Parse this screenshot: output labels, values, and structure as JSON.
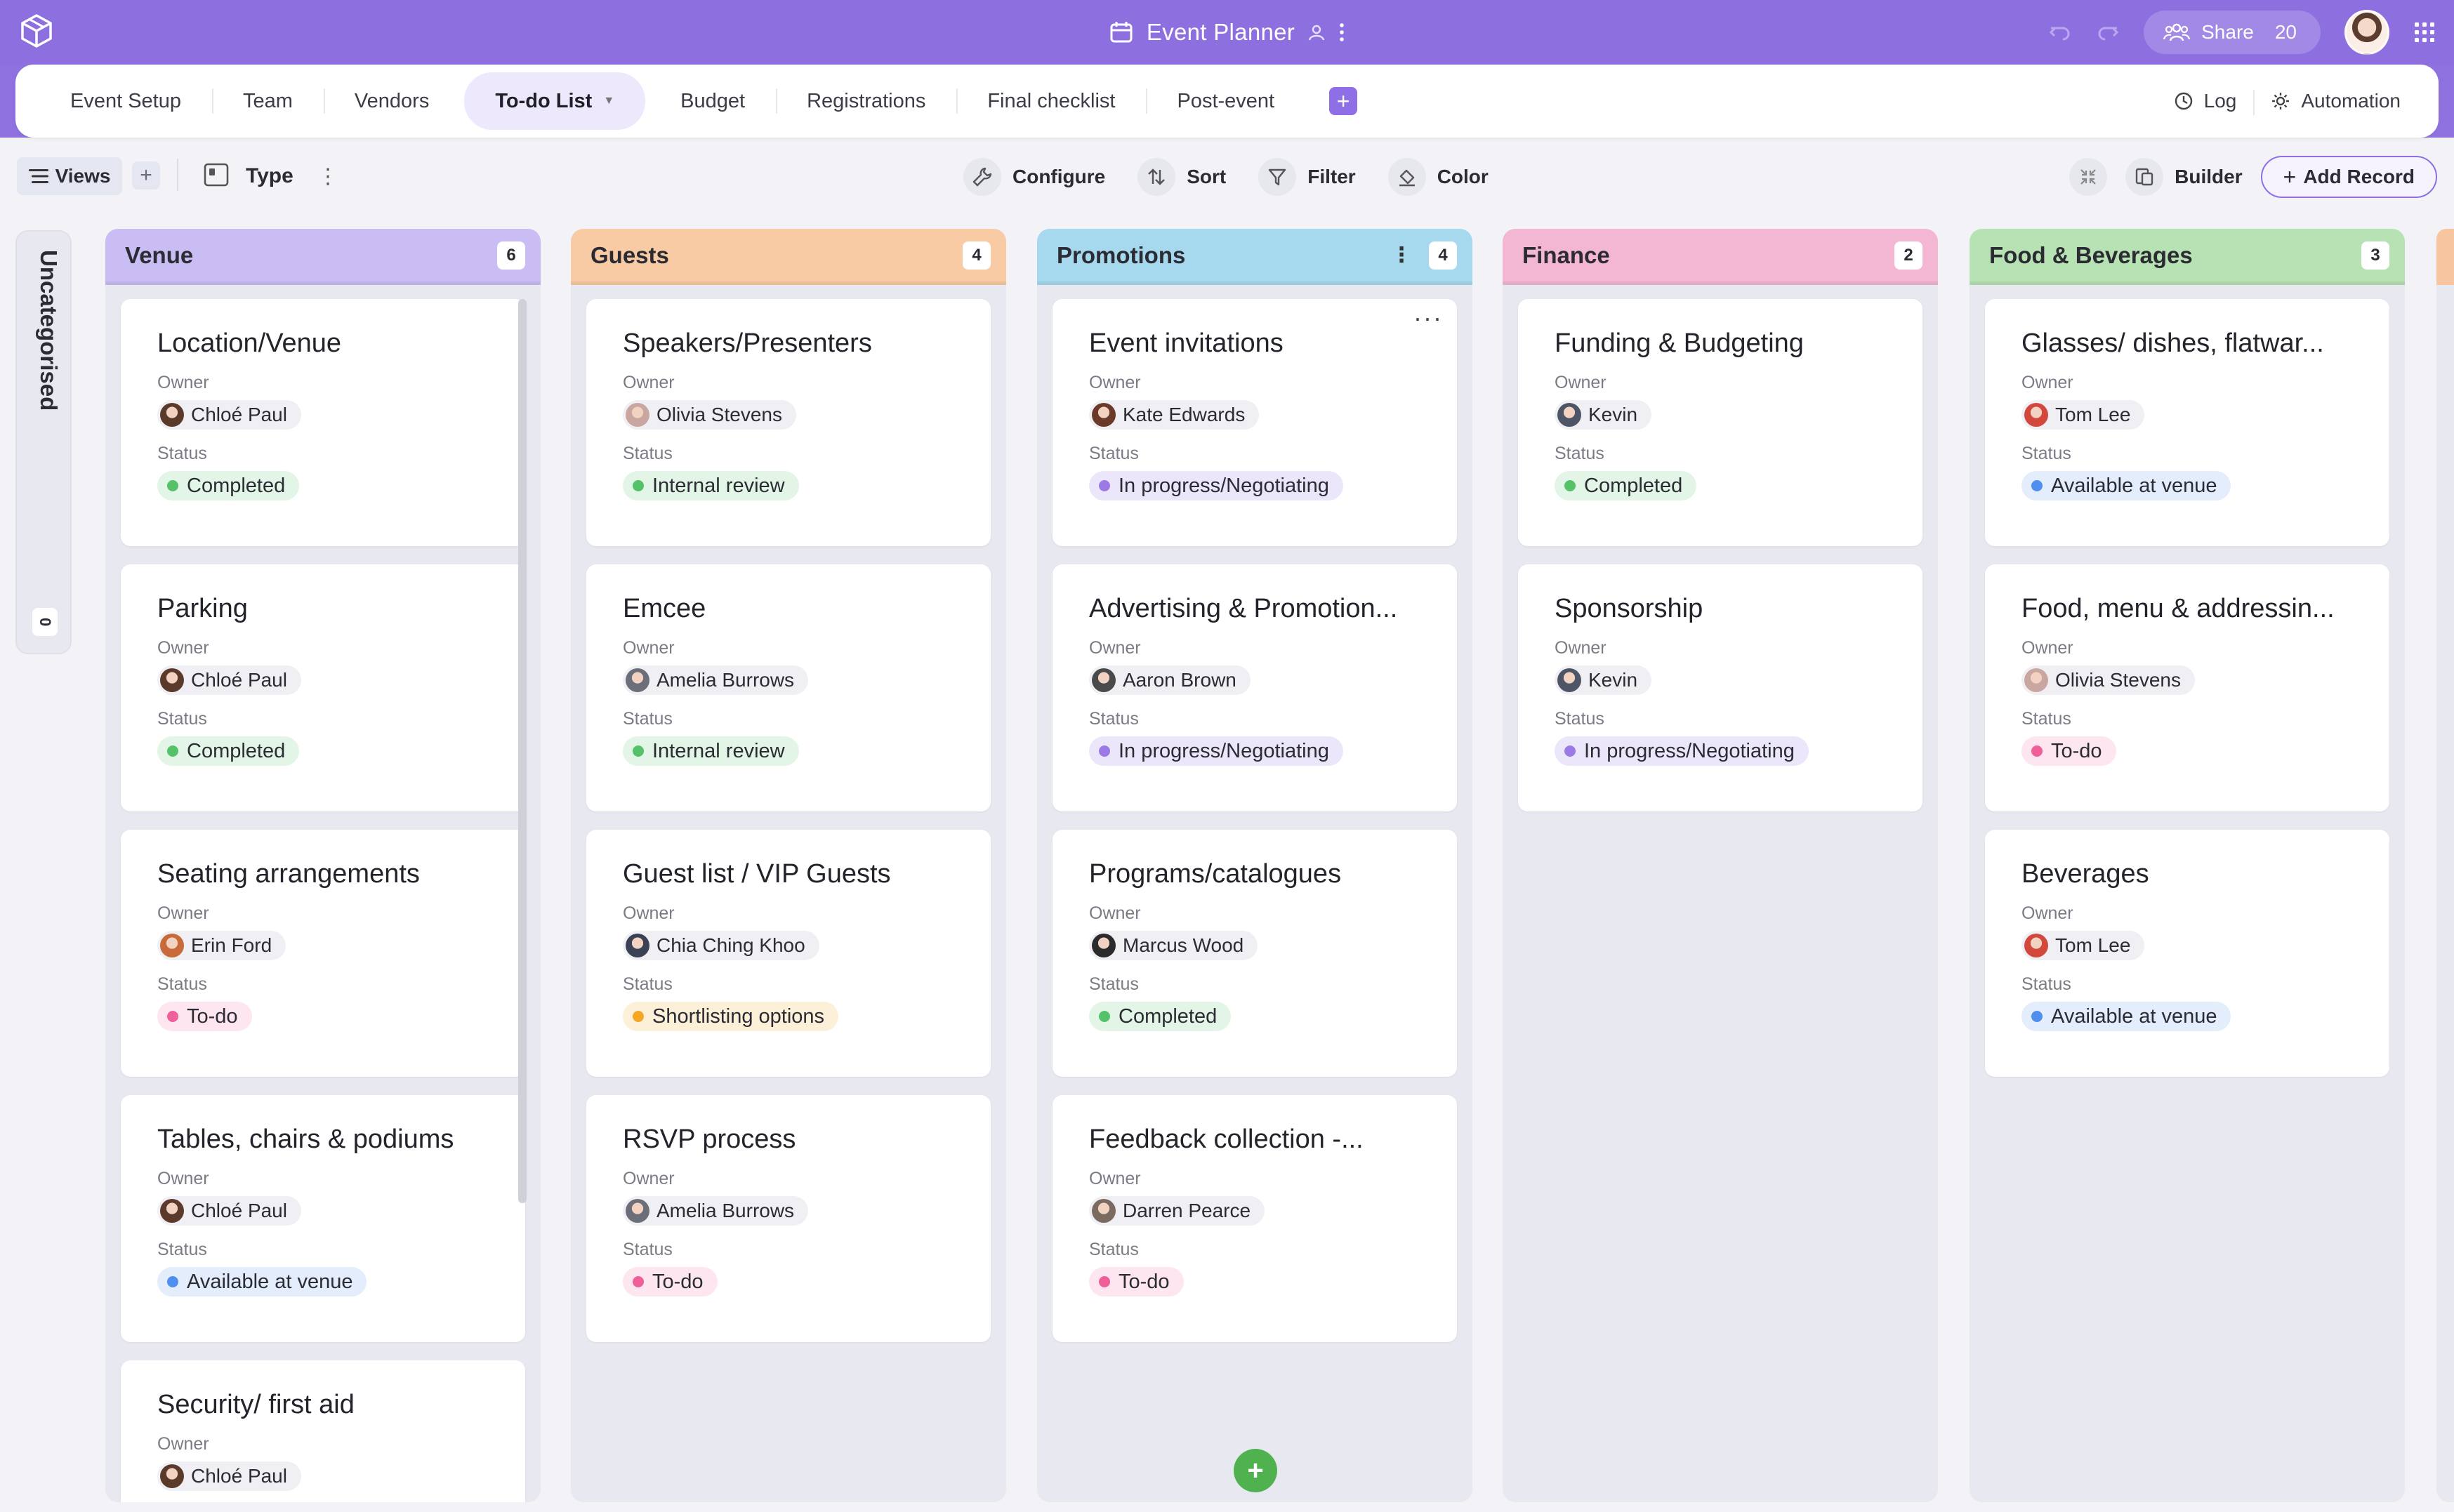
{
  "app": {
    "title": "Event Planner",
    "share_label": "Share",
    "share_count": "20"
  },
  "tabs": [
    {
      "label": "Event Setup"
    },
    {
      "label": "Team"
    },
    {
      "label": "Vendors"
    },
    {
      "label": "To-do List",
      "active": true
    },
    {
      "label": "Budget"
    },
    {
      "label": "Registrations"
    },
    {
      "label": "Final checklist"
    },
    {
      "label": "Post-event"
    }
  ],
  "tabs_right": {
    "log": "Log",
    "automation": "Automation"
  },
  "toolbar": {
    "views": "Views",
    "type": "Type",
    "configure": "Configure",
    "sort": "Sort",
    "filter": "Filter",
    "color": "Color",
    "builder": "Builder",
    "add_record": "Add Record"
  },
  "uncategorised": {
    "label": "Uncategorised",
    "count": "0"
  },
  "labels": {
    "owner": "Owner",
    "status": "Status"
  },
  "status_colors": {
    "Completed": {
      "dot": "#55c26a",
      "bg": "#e3f5e6"
    },
    "Internal review": {
      "dot": "#55c26a",
      "bg": "#e3f5e6"
    },
    "In progress/Negotiating": {
      "dot": "#9b7ae8",
      "bg": "#ece6fb"
    },
    "To-do": {
      "dot": "#ef5f9a",
      "bg": "#fde6ef"
    },
    "Available at venue": {
      "dot": "#4f8ff0",
      "bg": "#e3edfc"
    },
    "Shortlisting options": {
      "dot": "#f5a623",
      "bg": "#fdf0d9"
    }
  },
  "columns": [
    {
      "title": "Venue",
      "count": "6",
      "color": "#c9bdf4",
      "cards": [
        {
          "title": "Location/Venue",
          "owner": "Chloé Paul",
          "status": "Completed"
        },
        {
          "title": "Parking",
          "owner": "Chloé Paul",
          "status": "Completed"
        },
        {
          "title": "Seating arrangements",
          "owner": "Erin Ford",
          "status": "To-do"
        },
        {
          "title": "Tables, chairs & podiums",
          "owner": "Chloé Paul",
          "status": "Available at venue"
        },
        {
          "title": "Security/ first aid",
          "owner": "Chloé Paul",
          "status": ""
        }
      ]
    },
    {
      "title": "Guests",
      "count": "4",
      "color": "#f8cba4",
      "cards": [
        {
          "title": "Speakers/Presenters",
          "owner": "Olivia Stevens",
          "status": "Internal review"
        },
        {
          "title": "Emcee",
          "owner": "Amelia Burrows",
          "status": "Internal review"
        },
        {
          "title": "Guest list / VIP Guests",
          "owner": "Chia Ching Khoo",
          "status": "Shortlisting options"
        },
        {
          "title": "RSVP process",
          "owner": "Amelia Burrows",
          "status": "To-do"
        }
      ]
    },
    {
      "title": "Promotions",
      "count": "4",
      "color": "#a6d9ee",
      "cards": [
        {
          "title": "Event invitations",
          "owner": "Kate Edwards",
          "status": "In progress/Negotiating"
        },
        {
          "title": "Advertising & Promotion...",
          "owner": "Aaron Brown",
          "status": "In progress/Negotiating"
        },
        {
          "title": "Programs/catalogues",
          "owner": "Marcus Wood",
          "status": "Completed"
        },
        {
          "title": "Feedback collection -...",
          "owner": "Darren Pearce",
          "status": "To-do"
        }
      ]
    },
    {
      "title": "Finance",
      "count": "2",
      "color": "#f4b7d3",
      "cards": [
        {
          "title": "Funding & Budgeting",
          "owner": "Kevin",
          "status": "Completed"
        },
        {
          "title": "Sponsorship",
          "owner": "Kevin",
          "status": "In progress/Negotiating"
        }
      ]
    },
    {
      "title": "Food & Beverages",
      "count": "3",
      "color": "#b7e2b3",
      "cards": [
        {
          "title": "Glasses/ dishes, flatwar...",
          "owner": "Tom Lee",
          "status": "Available at venue"
        },
        {
          "title": "Food, menu & addressin...",
          "owner": "Olivia Stevens",
          "status": "To-do"
        },
        {
          "title": "Beverages",
          "owner": "Tom Lee",
          "status": "Available at venue"
        }
      ]
    }
  ],
  "avatar_colors": {
    "Chloé Paul": "#5b3a2c",
    "Erin Ford": "#c96a3b",
    "Olivia Stevens": "#c9a7a0",
    "Amelia Burrows": "#6c6f7a",
    "Chia Ching Khoo": "#3b4256",
    "Kate Edwards": "#6b3a2a",
    "Aaron Brown": "#4a4a4a",
    "Marcus Wood": "#2b2b2b",
    "Darren Pearce": "#7a6a60",
    "Kevin": "#4d5566",
    "Tom Lee": "#d2483d"
  }
}
